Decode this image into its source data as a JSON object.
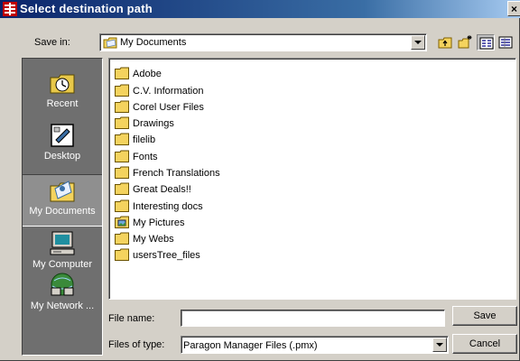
{
  "window": {
    "title": "Select destination path",
    "close_glyph": "×"
  },
  "toolbar": {
    "save_in_label": "Save in:",
    "save_in_value": "My Documents",
    "icons": [
      "up-one-level-icon",
      "create-new-folder-icon",
      "list-view-icon",
      "details-view-icon"
    ]
  },
  "places": [
    {
      "label": "Recent",
      "icon": "recent-clock-icon"
    },
    {
      "label": "Desktop",
      "icon": "desktop-icon"
    },
    {
      "label": "My Documents",
      "icon": "my-documents-icon",
      "selected": true
    },
    {
      "label": "My Computer",
      "icon": "my-computer-icon"
    },
    {
      "label": "My Network ...",
      "icon": "my-network-icon"
    }
  ],
  "files": [
    {
      "name": "Adobe",
      "icon": "folder-icon"
    },
    {
      "name": "C.V. Information",
      "icon": "folder-icon"
    },
    {
      "name": "Corel User Files",
      "icon": "folder-icon"
    },
    {
      "name": "Drawings",
      "icon": "folder-icon"
    },
    {
      "name": "filelib",
      "icon": "folder-icon"
    },
    {
      "name": "Fonts",
      "icon": "folder-icon"
    },
    {
      "name": "French Translations",
      "icon": "folder-icon"
    },
    {
      "name": "Great Deals!!",
      "icon": "folder-icon"
    },
    {
      "name": "Interesting docs",
      "icon": "folder-icon"
    },
    {
      "name": "My Pictures",
      "icon": "pictures-folder-icon"
    },
    {
      "name": "My Webs",
      "icon": "folder-icon"
    },
    {
      "name": "usersTree_files",
      "icon": "folder-icon"
    }
  ],
  "form": {
    "file_name_label": "File name:",
    "file_name_value": "",
    "files_of_type_label": "Files of type:",
    "files_of_type_value": "Paragon Manager Files (.pmx)",
    "save_label": "Save",
    "cancel_label": "Cancel"
  },
  "colors": {
    "titlebar_start": "#0a246a",
    "titlebar_end": "#a6caf0",
    "dialog_face": "#d4d0c8",
    "places_bar": "#6f6f6f",
    "folder_yellow": "#f4d35e"
  }
}
